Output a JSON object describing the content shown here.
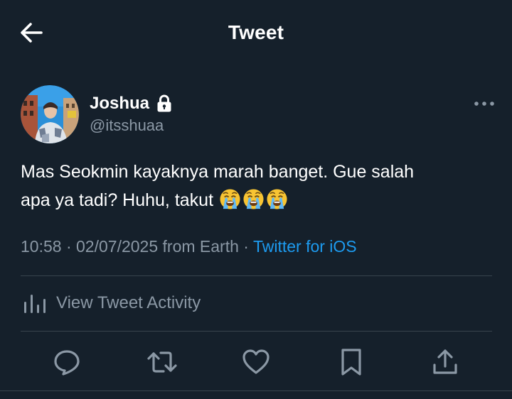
{
  "header": {
    "title": "Tweet",
    "back_icon": "arrow-left-icon"
  },
  "author": {
    "display_name": "Joshua",
    "handle": "@itsshuaa",
    "protected_icon": "lock-icon",
    "avatar_icon": "avatar-photo"
  },
  "tweet": {
    "text_line1": "Mas Seokmin kayaknya marah banget. Gue salah",
    "text_line2": "apa ya tadi? Huhu, takut",
    "emojis": [
      "loudly-crying-face",
      "loudly-crying-face",
      "loudly-crying-face"
    ]
  },
  "meta": {
    "time": "10:58",
    "separator": "·",
    "date": "02/07/2025",
    "location": "from Earth",
    "source": "Twitter for iOS"
  },
  "activity": {
    "label": "View Tweet Activity",
    "icon": "bar-chart-icon"
  },
  "actions": {
    "reply_icon": "reply-icon",
    "retweet_icon": "retweet-icon",
    "like_icon": "heart-icon",
    "bookmark_icon": "bookmark-icon",
    "share_icon": "share-icon"
  },
  "colors": {
    "background": "#15202b",
    "text_primary": "#ffffff",
    "text_secondary": "#8b98a5",
    "accent": "#1d9bf0",
    "divider": "#38444d"
  }
}
